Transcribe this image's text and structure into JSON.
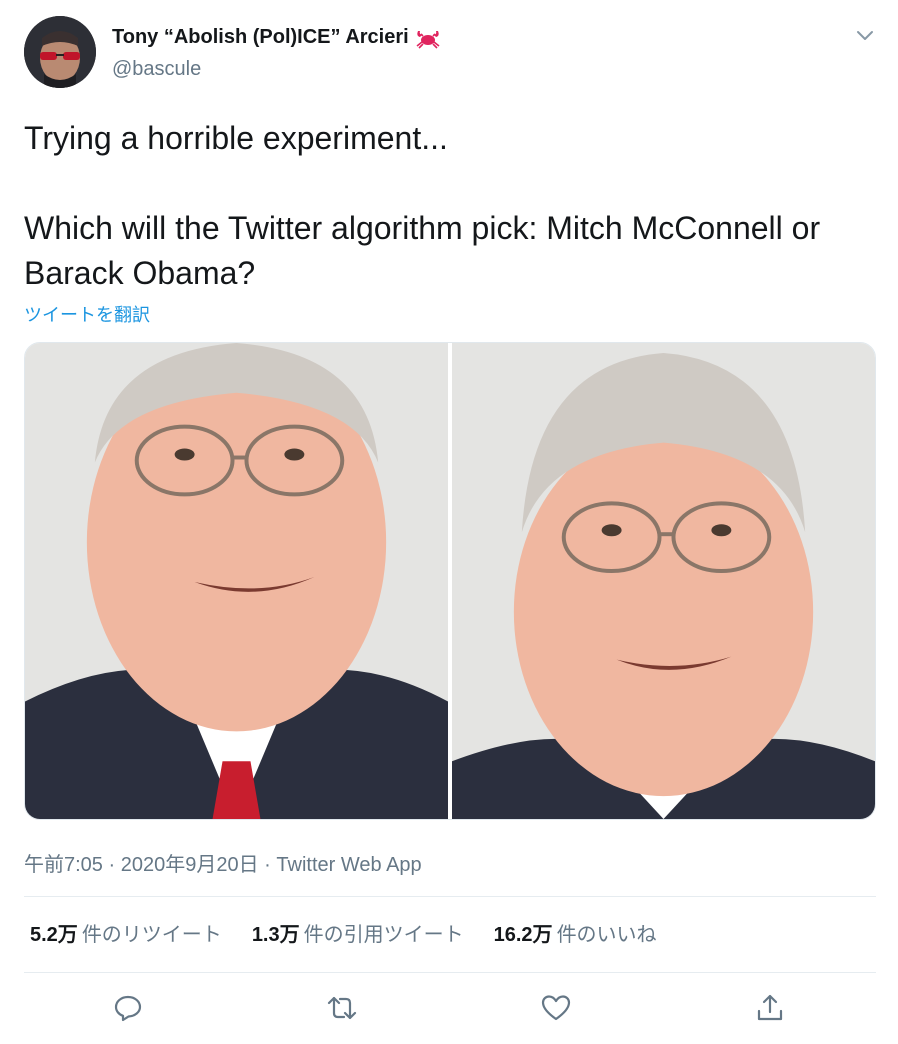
{
  "tweet": {
    "author": {
      "name": "Tony “Abolish (Pol)ICE” Arcieri",
      "handle": "@bascule",
      "name_emoji": "crab-icon"
    },
    "text_lines": [
      "Trying a horrible experiment...",
      "Which will the Twitter algorithm pick: Mitch McConnell or Barack Obama?"
    ],
    "translate_label": "ツイートを翻訳",
    "time": "午前7:05",
    "date": "2020年9月20日",
    "source": "Twitter Web App",
    "separator": "·",
    "stats": [
      {
        "count": "5.2万",
        "label": "件のリツイート"
      },
      {
        "count": "1.3万",
        "label": "件の引用ツイート"
      },
      {
        "count": "16.2万",
        "label": "件のいいね"
      }
    ],
    "actions": [
      "reply-icon",
      "retweet-icon",
      "like-icon",
      "share-icon"
    ]
  },
  "colors": {
    "link": "#1b95e0",
    "secondary_text": "#657786",
    "primary_text": "#14171a",
    "divider": "#e6ecf0",
    "crab": "#e0245e"
  }
}
